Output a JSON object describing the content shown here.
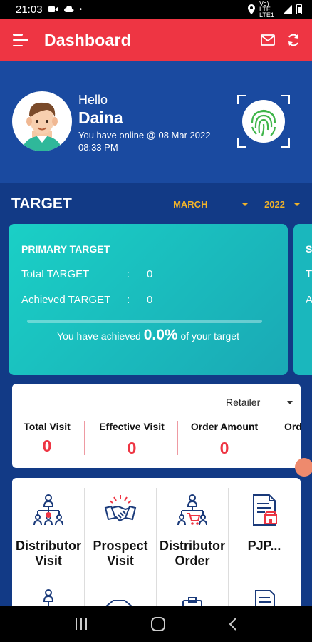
{
  "status_bar": {
    "time": "21:03",
    "network": "Vo) LTE LTE1"
  },
  "app_bar": {
    "title": "Dashboard"
  },
  "profile": {
    "greeting": "Hello",
    "name": "Daina",
    "online_text": "You have online @ 08 Mar 2022 08:33 PM"
  },
  "target": {
    "title": "TARGET",
    "month": "MARCH",
    "year": "2022"
  },
  "primary_target": {
    "title": "PRIMARY TARGET",
    "total_label": "Total TARGET",
    "total_value": "0",
    "achieved_label": "Achieved TARGET",
    "achieved_value": "0",
    "separator": ":",
    "msg_prefix": "You have achieved",
    "percent": "0.0%",
    "msg_suffix": "of your target",
    "progress": 0
  },
  "secondary_target_partial": {
    "title_letter": "S",
    "row1_letter": "T",
    "row2_letter": "A"
  },
  "visits": {
    "filter": "Retailer",
    "columns": [
      {
        "label": "Total Visit",
        "value": "0"
      },
      {
        "label": "Effective Visit",
        "value": "0"
      },
      {
        "label": "Order Amount",
        "value": "0"
      },
      {
        "label": "Ord",
        "value": ""
      }
    ]
  },
  "menu": {
    "items": [
      {
        "label": "Distributor Visit",
        "icon": "distributor-visit-icon"
      },
      {
        "label": "Prospect Visit",
        "icon": "handshake-icon"
      },
      {
        "label": "Distributor Order",
        "icon": "distributor-order-icon"
      },
      {
        "label": "PJP...",
        "icon": "pjp-document-icon"
      }
    ]
  },
  "colors": {
    "app_bar": "#ee3543",
    "background": "#123a86",
    "accent": "#f1b32a",
    "target_card": "#1ac3c0"
  }
}
